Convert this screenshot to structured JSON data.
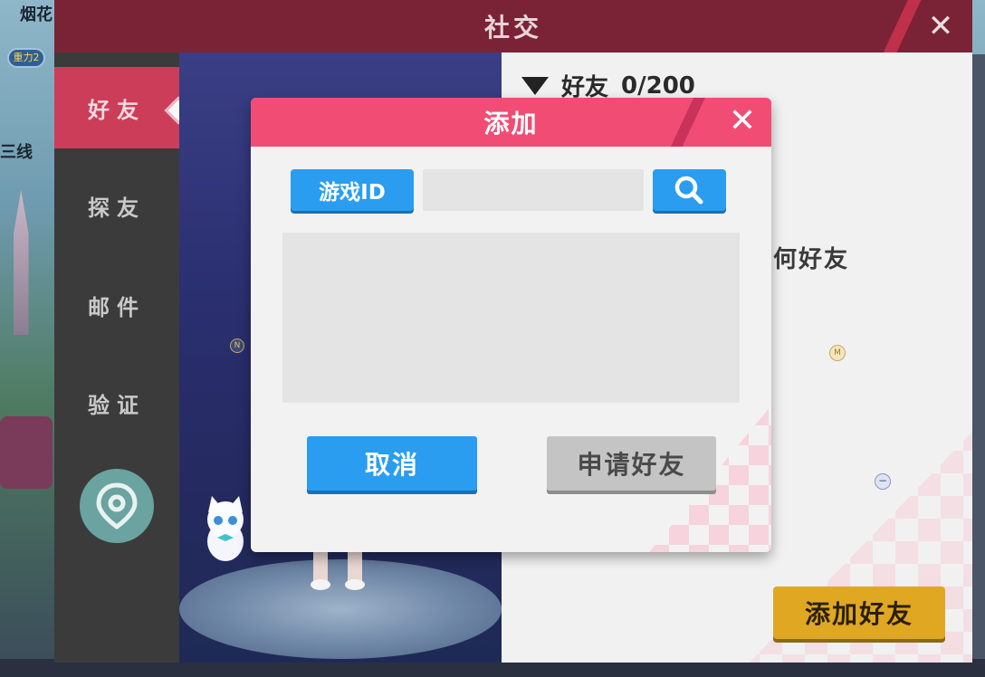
{
  "background": {
    "top_text": "烟花",
    "badge": "重力2",
    "line_text": "三线"
  },
  "panel": {
    "title": "社交",
    "close_icon": "close-icon"
  },
  "sidebar": {
    "items": [
      {
        "label": "好友",
        "active": true
      },
      {
        "label": "探友",
        "active": false
      },
      {
        "label": "邮件",
        "active": false
      },
      {
        "label": "验证",
        "active": false
      }
    ],
    "location_icon": "location-pin-icon"
  },
  "character_area": {
    "n_badge": "N"
  },
  "friends": {
    "section_title": "好友",
    "count": "0/200",
    "empty_text": "何好友",
    "m_badge": "M",
    "minus_badge": "−",
    "add_friend_label": "添加好友"
  },
  "modal": {
    "title": "添加",
    "id_label": "游戏ID",
    "id_input_value": "",
    "search_icon": "search-icon",
    "cancel_label": "取消",
    "apply_label": "申请好友"
  },
  "colors": {
    "modal_header": "#f14d74",
    "panel_header": "#7a2336",
    "primary_button": "#2a9df0",
    "disabled_button": "#c4c4c4",
    "add_button": "#e0a722",
    "active_tab": "#cc3d5a"
  }
}
